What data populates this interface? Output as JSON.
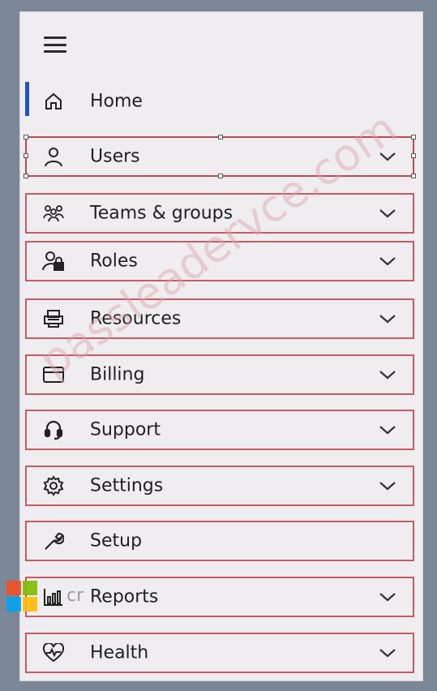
{
  "nav": {
    "menu_icon": "hamburger-icon",
    "items": [
      {
        "label": "Home",
        "icon": "home-icon",
        "expandable": false,
        "selected": true
      },
      {
        "label": "Users",
        "icon": "user-icon",
        "expandable": true
      },
      {
        "label": "Teams & groups",
        "icon": "teams-icon",
        "expandable": true
      },
      {
        "label": "Roles",
        "icon": "roles-icon",
        "expandable": true
      },
      {
        "label": "Resources",
        "icon": "resources-icon",
        "expandable": true
      },
      {
        "label": "Billing",
        "icon": "billing-icon",
        "expandable": true
      },
      {
        "label": "Support",
        "icon": "headset-icon",
        "expandable": true
      },
      {
        "label": "Settings",
        "icon": "gear-icon",
        "expandable": true
      },
      {
        "label": "Setup",
        "icon": "wrench-icon",
        "expandable": false
      },
      {
        "label": "Reports",
        "icon": "chart-icon",
        "expandable": true
      },
      {
        "label": "Health",
        "icon": "heart-icon",
        "expandable": true
      }
    ]
  },
  "overlay": {
    "text": "cr",
    "watermark": "passleadervce.com"
  },
  "colors": {
    "accent": "#1b55c4",
    "highlight_border": "#c65a66",
    "panel_bg": "#efedef",
    "frame_bg": "#7b8696"
  }
}
